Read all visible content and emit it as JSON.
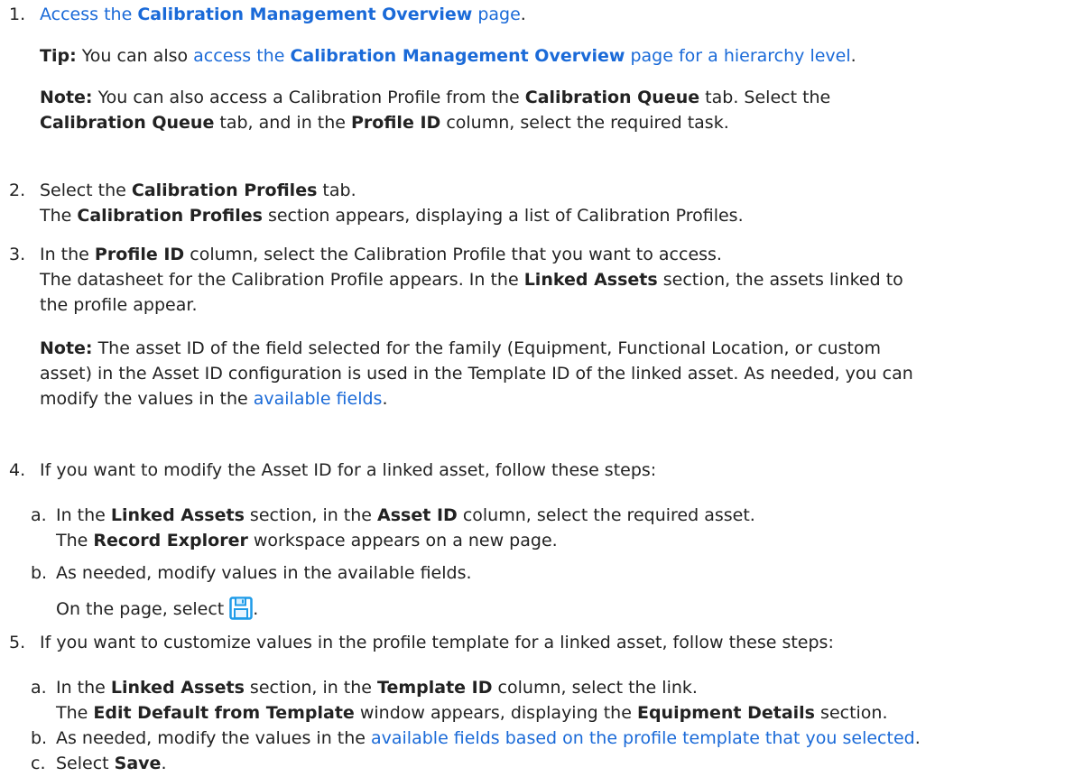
{
  "s1": {
    "num": "1.",
    "link_a": "Access the ",
    "link_b": "Calibration Management Overview",
    "link_c": " page",
    "end": ".",
    "tip_label": "Tip:",
    "tip_text": " You can also ",
    "tip_link_a": "access the ",
    "tip_link_b": "Calibration Management Overview",
    "tip_link_c": " page for a hierarchy level",
    "tip_end": ".",
    "note_label": "Note:",
    "note_t1": " You can also access a Calibration Profile from the ",
    "note_b1": "Calibration Queue",
    "note_t2": " tab. Select the",
    "note_b2": "Calibration Queue",
    "note_t3": " tab, and in the ",
    "note_b3": "Profile ID",
    "note_t4": " column, select the required task."
  },
  "s2": {
    "num": "2.",
    "t1": "Select the ",
    "b1": "Calibration Profiles",
    "t2": " tab.",
    "t3": "The ",
    "b2": "Calibration Profiles",
    "t4": " section appears, displaying a list of Calibration Profiles."
  },
  "s3": {
    "num": "3.",
    "t1": "In the ",
    "b1": "Profile ID",
    "t2": " column, select the Calibration Profile that you want to access.",
    "t3": "The datasheet for the Calibration Profile appears. In the ",
    "b2": "Linked Assets",
    "t4": " section, the assets linked to",
    "t5": "the profile appear.",
    "note_label": "Note:",
    "note_t1": " The asset ID of the field selected for the family (Equipment, Functional Location, or custom",
    "note_t2": "asset) in the Asset ID configuration is used in the Template ID of the linked asset. As needed, you can",
    "note_t3": "modify the values in the ",
    "note_link": "available fields",
    "note_end": "."
  },
  "s4": {
    "num": "4.",
    "t1": "If you want to modify the Asset ID for a linked asset, follow these steps:",
    "a": {
      "num": "a.",
      "t1": "In the ",
      "b1": "Linked Assets",
      "t2": " section, in the ",
      "b2": "Asset ID",
      "t3": " column, select the required asset.",
      "t4": "The ",
      "b3": "Record Explorer",
      "t5": " workspace appears on a new page."
    },
    "b": {
      "num": "b.",
      "t1": "As needed, modify values in the available fields.",
      "t2": "On the page, select ",
      "end": "."
    }
  },
  "s5": {
    "num": "5.",
    "t1": "If you want to customize values in the profile template for a linked asset, follow these steps:",
    "a": {
      "num": "a.",
      "t1": "In the ",
      "b1": "Linked Assets",
      "t2": " section, in the ",
      "b2": "Template ID",
      "t3": " column, select the link.",
      "t4": "The ",
      "b3": "Edit Default from Template",
      "t5": " window appears, displaying the ",
      "b4": "Equipment Details",
      "t6": " section."
    },
    "b": {
      "num": "b.",
      "t1": "As needed, modify the values in the ",
      "link": "available fields based on the profile template that you selected",
      "end": "."
    },
    "c": {
      "num": "c.",
      "t1": "Select ",
      "b1": "Save",
      "end": "."
    }
  },
  "icons": {
    "save": "save-icon"
  },
  "colors": {
    "link": "#1a6ad8",
    "text": "#222222",
    "save_icon": "#1e9be8"
  }
}
